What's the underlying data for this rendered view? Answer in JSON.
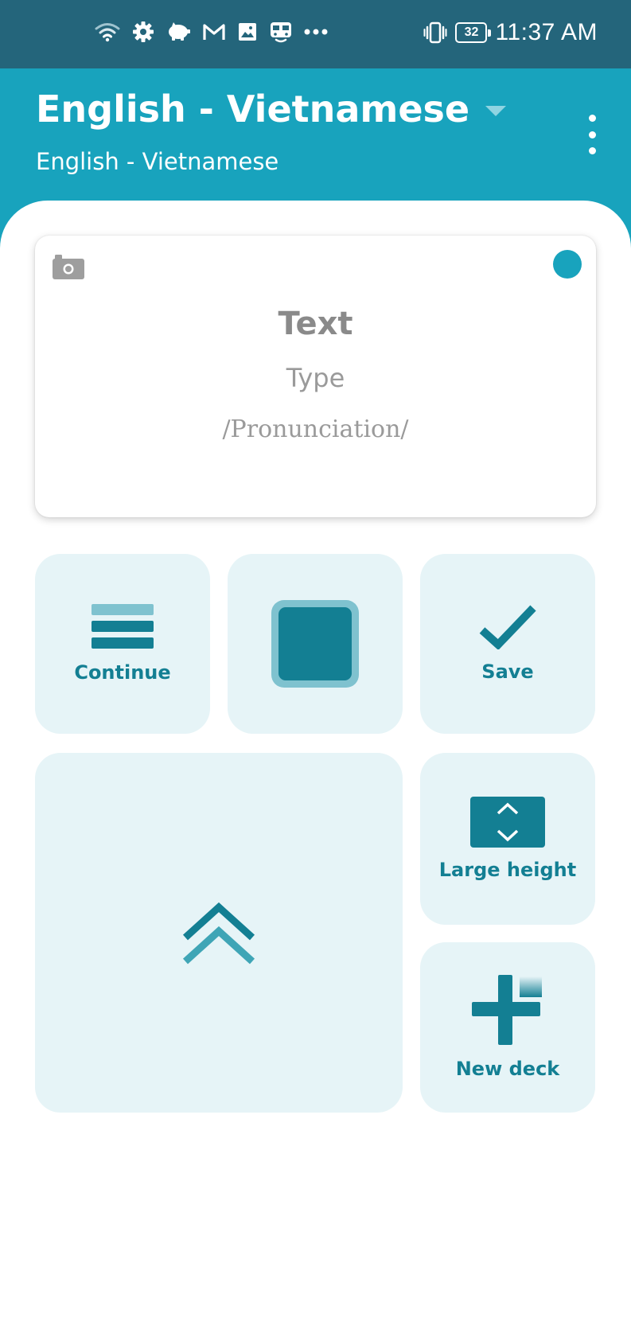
{
  "status_bar": {
    "time": "11:37 AM",
    "battery_level": "32",
    "icons": [
      "wifi-icon",
      "gear-icon",
      "piggy-bank-icon",
      "gmail-icon",
      "gallery-icon",
      "bus-icon",
      "more-notifications-icon",
      "vibrate-icon",
      "battery-icon"
    ]
  },
  "app_bar": {
    "title": "English - Vietnamese",
    "subtitle": "English - Vietnamese"
  },
  "card": {
    "text": "Text",
    "type": "Type",
    "pronunciation": "/Pronunciation/"
  },
  "tiles": {
    "continue_label": "Continue",
    "save_label": "Save",
    "large_height_label": "Large height",
    "new_deck_label": "New deck"
  },
  "colors": {
    "status_bar": "#24657b",
    "app_bar": "#18a3bd",
    "tile_background": "#e6f4f7",
    "tile_accent": "#137f93"
  }
}
